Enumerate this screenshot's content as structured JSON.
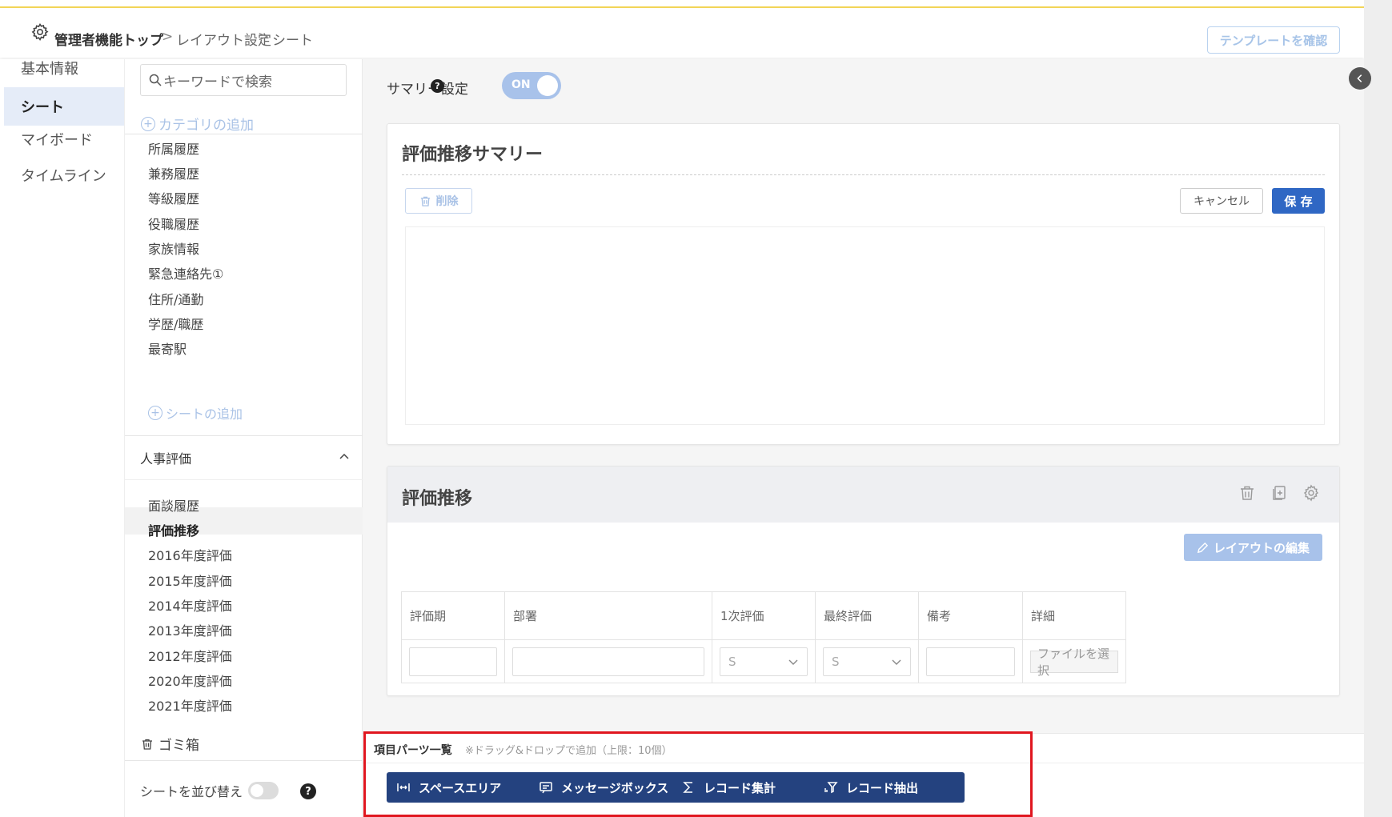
{
  "header": {
    "breadcrumb": [
      "管理者機能トップ",
      "レイアウト設定",
      "シート"
    ],
    "separator": ">",
    "template_button": "テンプレートを確認"
  },
  "leftnav": {
    "items": [
      "基本情報",
      "シート",
      "マイボード",
      "タイムライン"
    ],
    "active": "シート"
  },
  "sidebar": {
    "search_placeholder": "キーワードで検索",
    "add_category": "カテゴリの追加",
    "items": [
      "所属履歴",
      "兼務履歴",
      "等級履歴",
      "役職履歴",
      "家族情報",
      "緊急連絡先①",
      "住所/通勤",
      "学歴/職歴",
      "最寄駅"
    ],
    "add_sheet": "シートの追加",
    "category": "人事評価",
    "category_items": [
      "面談履歴",
      "評価推移",
      "2016年度評価",
      "2015年度評価",
      "2014年度評価",
      "2013年度評価",
      "2012年度評価",
      "2020年度評価",
      "2021年度評価"
    ],
    "active_item": "評価推移",
    "trash": "ゴミ箱",
    "sort_label": "シートを並び替え"
  },
  "main": {
    "summary_label": "サマリー設定",
    "summary_toggle": "ON",
    "summary_card": {
      "title": "評価推移サマリー",
      "delete": "削除",
      "cancel": "キャンセル",
      "save": "保 存"
    },
    "sheet_card": {
      "title": "評価推移",
      "edit_layout": "レイアウトの編集",
      "columns": [
        "評価期",
        "部署",
        "1次評価",
        "最終評価",
        "備考",
        "詳細"
      ],
      "select_value_1": "S",
      "select_value_2": "S",
      "file_button": "ファイルを選択"
    }
  },
  "parts": {
    "title": "項目パーツ一覧",
    "note": "※ドラッグ&ドロップで追加（上限：10個）",
    "buttons": [
      "スペースエリア",
      "メッセージボックス",
      "レコード集計",
      "レコード抽出"
    ]
  },
  "colors": {
    "primary": "#2f67c4",
    "parts_button": "#24427f",
    "highlight": "#e0161f",
    "accent_line": "#f3d658"
  }
}
